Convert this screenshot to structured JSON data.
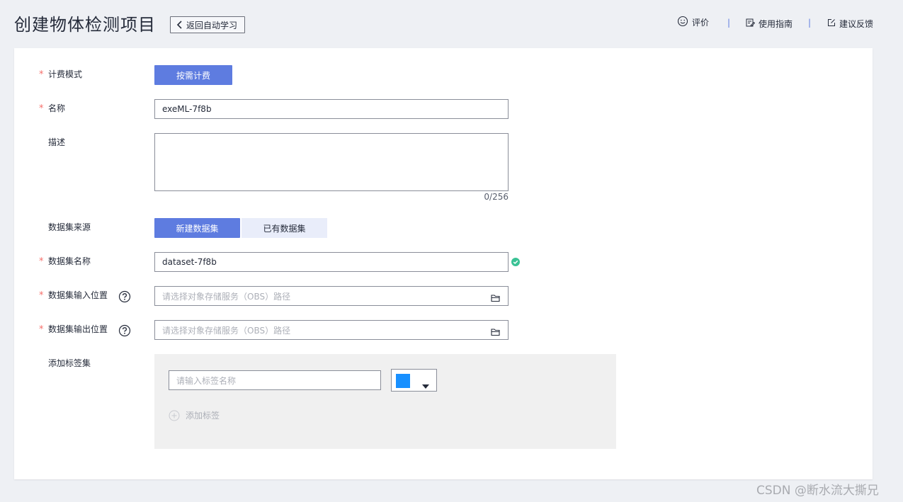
{
  "header": {
    "title": "创建物体检测项目",
    "back_label": "返回自动学习",
    "links": {
      "rate": "评价",
      "guide": "使用指南",
      "feedback": "建议反馈"
    },
    "separator": "|"
  },
  "form": {
    "billing": {
      "label": "计费模式",
      "value": "按需计费"
    },
    "name": {
      "label": "名称",
      "value": "exeML-7f8b"
    },
    "description": {
      "label": "描述",
      "value": "",
      "counter": "0/256"
    },
    "dataset_source": {
      "label": "数据集来源",
      "options": [
        "新建数据集",
        "已有数据集"
      ],
      "selected": "新建数据集"
    },
    "dataset_name": {
      "label": "数据集名称",
      "value": "dataset-7f8b"
    },
    "input_location": {
      "label": "数据集输入位置",
      "placeholder": "请选择对象存储服务（OBS）路径"
    },
    "output_location": {
      "label": "数据集输出位置",
      "placeholder": "请选择对象存储服务（OBS）路径"
    },
    "label_set": {
      "label": "添加标签集",
      "name_placeholder": "请输入标签名称",
      "color": "#1890ff",
      "add_label": "添加标签"
    }
  },
  "colors": {
    "primary": "#5e7ce0",
    "required": "#f66f6a",
    "success": "#3ac295"
  },
  "watermark": "CSDN @断水流大撕兄"
}
